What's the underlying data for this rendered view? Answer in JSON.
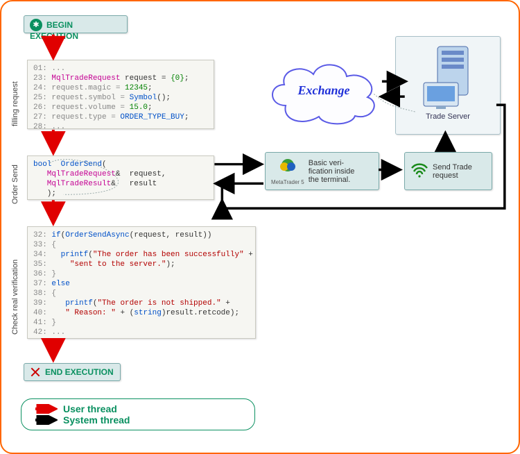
{
  "pill_begin": "BEGIN EXECUTION",
  "pill_end": "END EXECUTION",
  "section_labels": {
    "filling": "filling request",
    "ordersend": "Order Send",
    "check": "Check real verification"
  },
  "code1": {
    "l01": "01: ...",
    "l23a": "23: ",
    "l23b": "MqlTradeRequest",
    "l23c": " request = ",
    "l23d": "{0}",
    "l23e": ";",
    "l24": "24: request.magic = ",
    "l24n": "12345",
    "l24e": ";",
    "l25": "25: request.symbol = ",
    "l25f": "Symbol",
    "l25e": "();",
    "l26": "26: request.volume = ",
    "l26n": "15.0",
    "l26e": ";",
    "l27": "27: request.type = ",
    "l27c": "ORDER_TYPE_BUY",
    "l27e": ";",
    "l28": "28: ..."
  },
  "code2": {
    "l1a": "bool",
    "l1b": "  OrderSend",
    "l1c": "(",
    "l2a": "   MqlTradeRequest",
    "l2b": "&  request,",
    "l3a": "   MqlTradeResult",
    "l3b": "&   result",
    "l4": "   );"
  },
  "code3": {
    "l32a": "32: ",
    "l32b": "if",
    "l32c": "(",
    "l32d": "OrderSendAsync",
    "l32e": "(request, result))",
    "l33": "33: {",
    "l34a": "34:   ",
    "l34b": "printf",
    "l34c": "(",
    "l34d": "\"The order has been successfully\"",
    "l34e": " +",
    "l35a": "35:     ",
    "l35b": "\"sent to the server.\"",
    "l35c": ");",
    "l36": "36: }",
    "l37a": "37: ",
    "l37b": "else",
    "l38": "38: {",
    "l39a": "39:    ",
    "l39b": "printf",
    "l39c": "(",
    "l39d": "\"The order is not shipped.\"",
    "l39e": " +",
    "l40a": "40:    ",
    "l40b": "\" Reason: \"",
    "l40c": " + (",
    "l40d": "string",
    "l40e": ")result.retcode);",
    "l41": "41: }",
    "l42": "42: ..."
  },
  "verif_box": "Basic veri-\nfication inside\nthe terminal.",
  "mt5_label": "MetaTrader 5",
  "send_box": "Send Trade\nrequest",
  "exchange_label": "Exchange",
  "server_label": "Trade Server",
  "legend": {
    "user": "User thread",
    "system": "System thread"
  }
}
